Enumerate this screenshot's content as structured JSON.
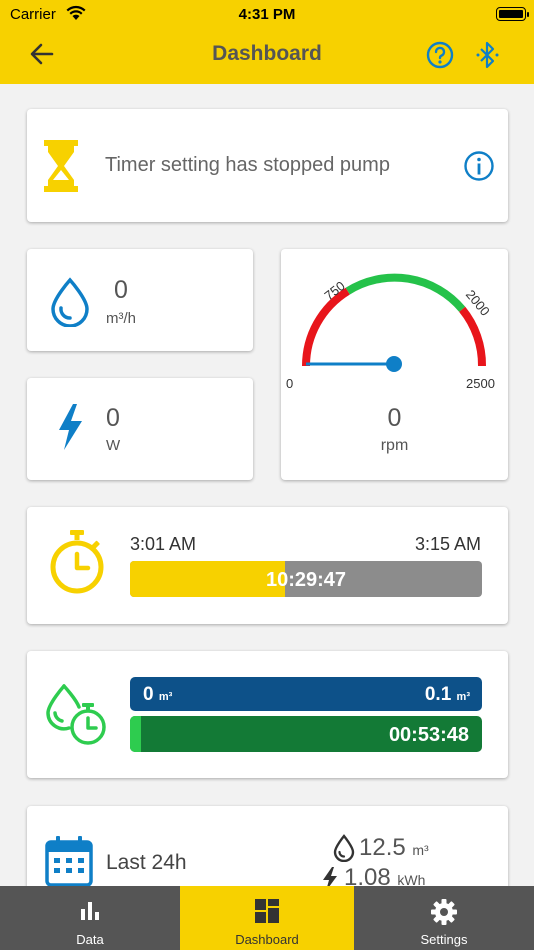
{
  "status_bar": {
    "carrier": "Carrier",
    "time": "4:31 PM"
  },
  "nav": {
    "title": "Dashboard",
    "back_icon": "back-arrow-icon",
    "help_icon": "help-icon",
    "bluetooth_icon": "bluetooth-icon"
  },
  "status_card": {
    "message": "Timer setting has stopped pump",
    "icon": "hourglass-icon"
  },
  "flow": {
    "value": "0",
    "unit": "m³/h"
  },
  "power": {
    "value": "0",
    "unit": "W"
  },
  "gauge": {
    "min_label": "0",
    "max_label": "2500",
    "mark_low": "750",
    "mark_high": "2000",
    "value": "0",
    "unit": "rpm",
    "level": 0,
    "min": 0,
    "max": 2500
  },
  "timer": {
    "start": "3:01 AM",
    "end": "3:15 AM",
    "remaining": "10:29:47",
    "progress_percent": 44
  },
  "volume": {
    "current": "0",
    "target": "0.1",
    "unit": "m³",
    "elapsed": "00:53:48",
    "progress_percent": 3
  },
  "summary": {
    "label": "Last 24h",
    "volume": "12.5",
    "volume_unit": "m³",
    "energy": "1.08",
    "energy_unit": "kWh"
  },
  "tabs": [
    {
      "label": "Data"
    },
    {
      "label": "Dashboard"
    },
    {
      "label": "Settings"
    }
  ],
  "colors": {
    "brand_yellow": "#f7d100",
    "blue": "#0f7fc7",
    "green": "#2ecc4f",
    "dark_green": "#137a36",
    "navy": "#0d5189",
    "gauge_red": "#e8151b",
    "gauge_green": "#25c24a"
  }
}
